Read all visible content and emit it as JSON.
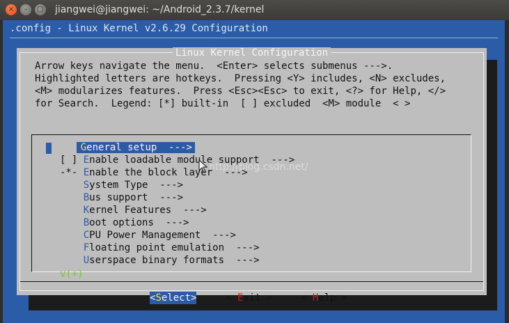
{
  "window": {
    "title": "jiangwei@jiangwei: ~/Android_2.3.7/kernel",
    "close_glyph": "×",
    "minimize_glyph": "–",
    "maximize_glyph": "□"
  },
  "terminal": {
    "config_header": ".config - Linux Kernel v2.6.29 Configuration"
  },
  "dialog": {
    "title": "Linux Kernel Configuration",
    "intro_lines": [
      "Arrow keys navigate the menu.  <Enter> selects submenus --->.",
      "Highlighted letters are hotkeys.  Pressing <Y> includes, <N> excludes,",
      "<M> modularizes features.  Press <Esc><Esc> to exit, <?> for Help, </>",
      "for Search.  Legend: [*] built-in  [ ] excluded  <M> module  < >"
    ]
  },
  "menu": {
    "items": [
      {
        "prefix": "    ",
        "hotkey": "G",
        "rest": "eneral setup  --->"
      },
      {
        "prefix": "[ ] ",
        "hotkey": "E",
        "rest": "nable loadable module support  --->"
      },
      {
        "prefix": "-*- ",
        "hotkey": "E",
        "rest": "nable the block layer  --->"
      },
      {
        "prefix": "    ",
        "hotkey": "S",
        "rest": "ystem Type  --->"
      },
      {
        "prefix": "    ",
        "hotkey": "B",
        "rest": "us support  --->"
      },
      {
        "prefix": "    ",
        "hotkey": "K",
        "rest": "ernel Features  --->"
      },
      {
        "prefix": "    ",
        "hotkey": "B",
        "rest": "oot options  --->"
      },
      {
        "prefix": "    ",
        "hotkey": "C",
        "rest": "PU Power Management  --->"
      },
      {
        "prefix": "    ",
        "hotkey": "F",
        "rest": "loating point emulation  --->"
      },
      {
        "prefix": "    ",
        "hotkey": "U",
        "rest": "serspace binary formats  --->"
      }
    ],
    "more_indicator": "v(+)"
  },
  "buttons": {
    "select": {
      "open": "<",
      "hotkey": "S",
      "rest": "elect>"
    },
    "exit": {
      "open": "< ",
      "hotkey": "E",
      "rest": "xit >"
    },
    "help": {
      "open": "< ",
      "hotkey": "H",
      "rest": "elp >"
    }
  },
  "watermark": "http://blog.csdn.net/",
  "colors": {
    "terminal_bg": "#2b5ca7",
    "dialog_bg": "#bebebe",
    "selection": "#2d5aa5",
    "hotkey": "#b7221a",
    "selected_hotkey": "#f5e24a"
  }
}
